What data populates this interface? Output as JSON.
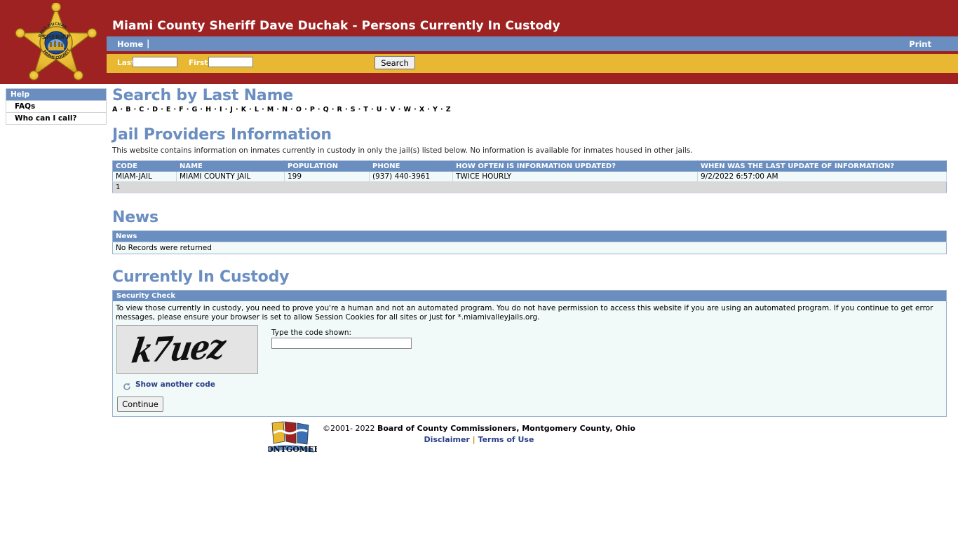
{
  "header": {
    "title": "Miami County Sheriff Dave Duchak - Persons Currently In Custody",
    "badge_alt": "sheriff-badge",
    "nav": {
      "home_label": "Home",
      "separator": "|",
      "print_label": "Print"
    },
    "search": {
      "last_label": "Last",
      "last_value": "",
      "last_placeholder": "",
      "first_label": "First",
      "first_value": "",
      "first_placeholder": "",
      "button_label": "Search"
    },
    "colors": {
      "banner_red": "#9e2222",
      "nav_blue": "#6a8ec0",
      "search_gold": "#e8b832"
    }
  },
  "sidebar": {
    "heading": "Help",
    "items": [
      {
        "label": "FAQs"
      },
      {
        "label": "Who can I call?"
      }
    ]
  },
  "main": {
    "search_by_last_name": {
      "title": "Search by Last Name",
      "letters": [
        "A",
        "B",
        "C",
        "D",
        "E",
        "F",
        "G",
        "H",
        "I",
        "J",
        "K",
        "L",
        "M",
        "N",
        "O",
        "P",
        "Q",
        "R",
        "S",
        "T",
        "U",
        "V",
        "W",
        "X",
        "Y",
        "Z"
      ],
      "separator": "·"
    },
    "jail_providers": {
      "title": "Jail Providers Information",
      "description": "This website contains information on inmates currently in custody in only the jail(s) listed below. No information is available for inmates housed in other jails.",
      "columns": [
        "CODE",
        "NAME",
        "POPULATION",
        "PHONE",
        "HOW OFTEN IS INFORMATION UPDATED?",
        "WHEN WAS THE LAST UPDATE OF INFORMATION?"
      ],
      "rows": [
        {
          "code": "MIAM-JAIL",
          "name": "MIAMI COUNTY JAIL",
          "population": "199",
          "phone": "(937) 440-3961",
          "update_frequency": "TWICE HOURLY",
          "last_update": "9/2/2022 6:57:00 AM"
        }
      ],
      "pager": "1"
    },
    "news": {
      "title": "News",
      "column": "News",
      "empty_message": "No Records were returned"
    },
    "currently_in_custody": {
      "title": "Currently In Custody",
      "security_check": {
        "heading": "Security Check",
        "instructions": "To view those currently in custody, you need to prove you're a human and not an automated program. You do not have permission to access this website if you are using an automated program. If you continue to get error messages, please ensure your browser is set to allow Session Cookies for all sites or just for *.miamivalleyjails.org.",
        "captcha_code": "k7uez",
        "code_label": "Type the code shown:",
        "code_value": "",
        "code_placeholder": "",
        "another_code_label": "Show another code",
        "continue_label": "Continue"
      }
    }
  },
  "footer": {
    "logo_alt": "montgomery-county-logo",
    "copyright_symbol": "©2001- 2022",
    "copyright_owner": "Board of County Commissioners, Montgomery County, Ohio",
    "disclaimer_label": "Disclaimer",
    "links_separator": "|",
    "terms_label": "Terms of Use"
  }
}
